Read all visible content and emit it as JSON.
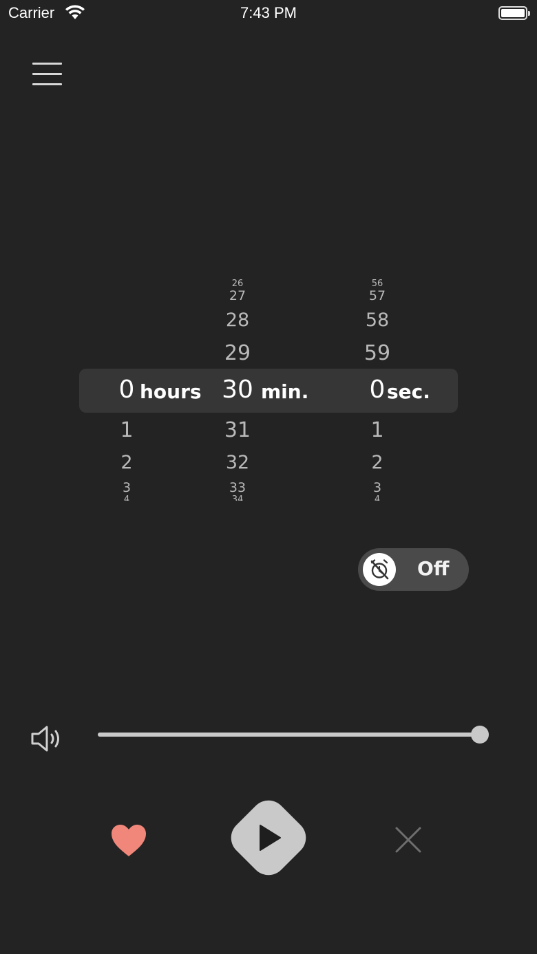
{
  "status_bar": {
    "carrier": "Carrier",
    "time": "7:43 PM",
    "icons": [
      "wifi-icon",
      "battery-icon"
    ]
  },
  "menu": {
    "icon": "hamburger-menu-icon"
  },
  "picker": {
    "hours": {
      "above": [],
      "selected": "0",
      "below": [
        "1",
        "2",
        "3",
        "4"
      ],
      "unit": "hours"
    },
    "minutes": {
      "above": [
        "26",
        "27",
        "28",
        "29"
      ],
      "selected": "30",
      "below": [
        "31",
        "32",
        "33",
        "34"
      ],
      "unit": "min."
    },
    "seconds": {
      "above": [
        "56",
        "57",
        "58",
        "59"
      ],
      "selected": "0",
      "below": [
        "1",
        "2",
        "3",
        "4"
      ],
      "unit": "sec."
    }
  },
  "alarm_toggle": {
    "label": "Off",
    "icon": "alarm-off-icon",
    "state": false
  },
  "volume": {
    "icon": "speaker-icon",
    "level": 1.0
  },
  "controls": {
    "favorite_icon": "heart-icon",
    "play_icon": "play-icon",
    "close_icon": "close-icon"
  },
  "colors": {
    "background": "#232323",
    "picker_highlight": "#363636",
    "heart": "#f0877a",
    "play_button": "#c9c9c9",
    "toggle_track": "#4a4a4a"
  }
}
